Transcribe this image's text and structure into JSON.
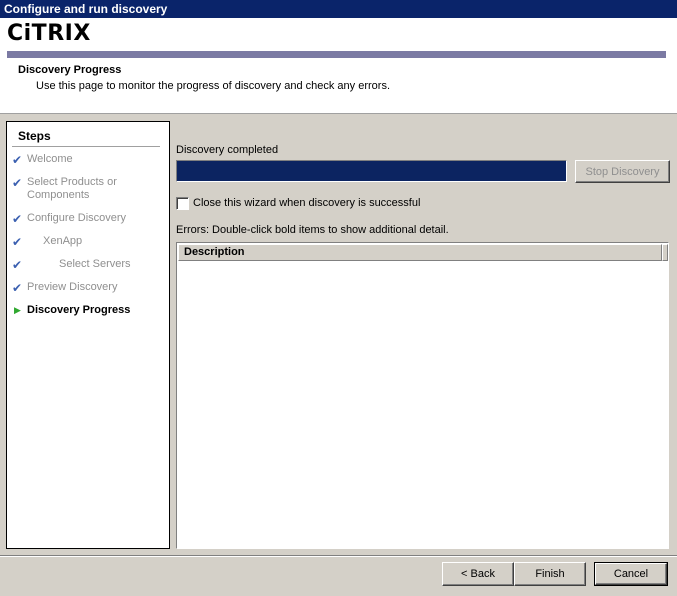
{
  "window": {
    "title": "Configure and run discovery"
  },
  "header": {
    "logo": "CiTRIX",
    "title": "Discovery Progress",
    "subtitle": "Use this page to monitor the progress of discovery and check any errors."
  },
  "steps": {
    "title": "Steps",
    "items": [
      {
        "label": "Welcome",
        "state": "done"
      },
      {
        "label": "Select Products or Components",
        "state": "done"
      },
      {
        "label": "Configure Discovery",
        "state": "done"
      },
      {
        "label": "XenApp",
        "state": "done"
      },
      {
        "label": "Select Servers",
        "state": "done"
      },
      {
        "label": "Preview Discovery",
        "state": "done"
      },
      {
        "label": "Discovery Progress",
        "state": "current"
      }
    ],
    "check_mark": "✔",
    "current_mark": "▶"
  },
  "main": {
    "status_text": "Discovery completed",
    "progress_percent": 100,
    "stop_button": "Stop Discovery",
    "close_checkbox": {
      "label": "Close this wizard when discovery is successful",
      "checked": false
    },
    "errors_label": "Errors: Double-click bold items to show additional detail.",
    "errors_table": {
      "columns": [
        "Description"
      ],
      "rows": []
    }
  },
  "footer": {
    "back_button": "< Back",
    "finish_button": "Finish",
    "cancel_button": "Cancel"
  },
  "colors": {
    "title_bar": "#0a246a",
    "progress_fill": "#0c2461",
    "brand_bar": "#7b7aa3",
    "check_color": "#3a5fb0",
    "current_arrow": "#2fa82f"
  }
}
